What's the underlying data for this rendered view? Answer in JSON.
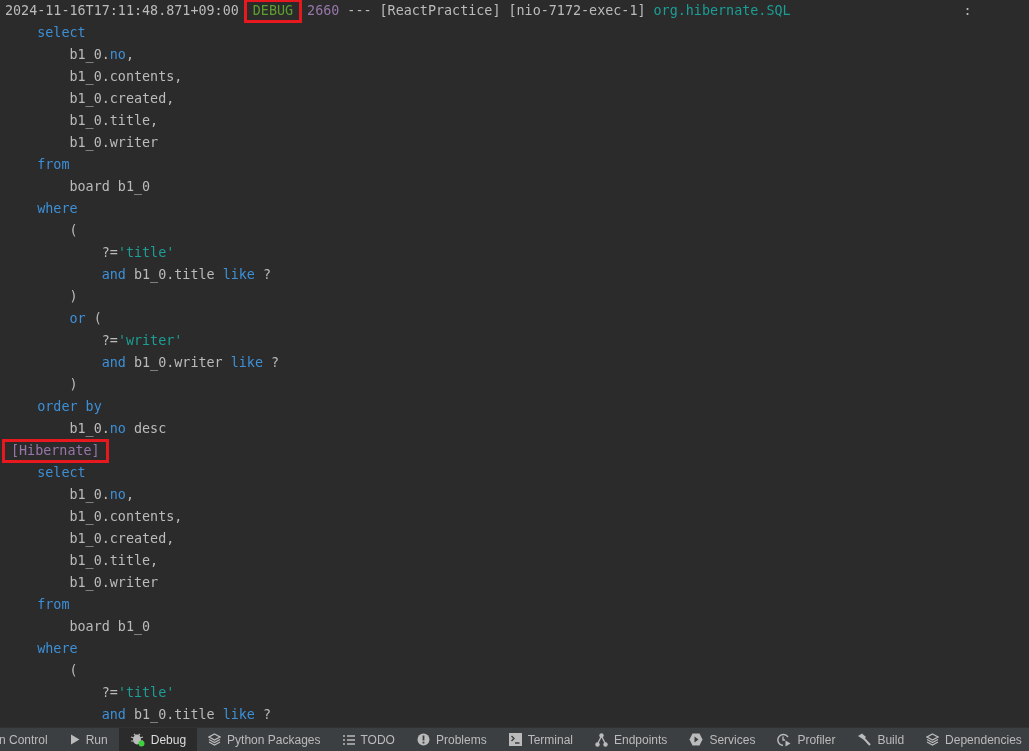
{
  "console": {
    "lines": [
      {
        "kind": "header",
        "tokens": [
          {
            "text": "2024-11-16T17:11:48.871+09:00",
            "kind": "timestamp"
          },
          {
            "text": "DEBUG",
            "kind": "level",
            "boxed": true
          },
          {
            "text": "2660",
            "kind": "pid"
          },
          {
            "text": "---",
            "kind": "plain"
          },
          {
            "text": "[ReactPractice]",
            "kind": "plain"
          },
          {
            "text": "[nio-7172-exec-1]",
            "kind": "plain"
          },
          {
            "text": "org.hibernate.SQL",
            "kind": "logger"
          },
          {
            "text": ":",
            "kind": "colon"
          }
        ]
      },
      {
        "kind": "code",
        "tokens": [
          {
            "text": "    select",
            "kind": "keyword"
          }
        ]
      },
      {
        "kind": "code",
        "tokens": [
          {
            "text": "        b1_0.",
            "kind": "plain"
          },
          {
            "text": "no",
            "kind": "keyword"
          },
          {
            "text": ",",
            "kind": "plain"
          }
        ]
      },
      {
        "kind": "code",
        "tokens": [
          {
            "text": "        b1_0.contents,",
            "kind": "plain"
          }
        ]
      },
      {
        "kind": "code",
        "tokens": [
          {
            "text": "        b1_0.created,",
            "kind": "plain"
          }
        ]
      },
      {
        "kind": "code",
        "tokens": [
          {
            "text": "        b1_0.title,",
            "kind": "plain"
          }
        ]
      },
      {
        "kind": "code",
        "tokens": [
          {
            "text": "        b1_0.writer",
            "kind": "plain"
          }
        ]
      },
      {
        "kind": "code",
        "tokens": [
          {
            "text": "    from",
            "kind": "keyword"
          }
        ]
      },
      {
        "kind": "code",
        "tokens": [
          {
            "text": "        board b1_0",
            "kind": "plain"
          }
        ]
      },
      {
        "kind": "code",
        "tokens": [
          {
            "text": "    where",
            "kind": "keyword"
          }
        ]
      },
      {
        "kind": "code",
        "tokens": [
          {
            "text": "        (",
            "kind": "plain"
          }
        ]
      },
      {
        "kind": "code",
        "tokens": [
          {
            "text": "            ?=",
            "kind": "plain"
          },
          {
            "text": "'title'",
            "kind": "string"
          }
        ]
      },
      {
        "kind": "code",
        "tokens": [
          {
            "text": "            and",
            "kind": "keyword"
          },
          {
            "text": " b1_0.title ",
            "kind": "plain"
          },
          {
            "text": "like",
            "kind": "keyword"
          },
          {
            "text": " ?",
            "kind": "plain"
          }
        ]
      },
      {
        "kind": "code",
        "tokens": [
          {
            "text": "        )",
            "kind": "plain"
          }
        ]
      },
      {
        "kind": "code",
        "tokens": [
          {
            "text": "        or",
            "kind": "keyword"
          },
          {
            "text": " (",
            "kind": "plain"
          }
        ]
      },
      {
        "kind": "code",
        "tokens": [
          {
            "text": "            ?=",
            "kind": "plain"
          },
          {
            "text": "'writer'",
            "kind": "string"
          }
        ]
      },
      {
        "kind": "code",
        "tokens": [
          {
            "text": "            and",
            "kind": "keyword"
          },
          {
            "text": " b1_0.writer ",
            "kind": "plain"
          },
          {
            "text": "like",
            "kind": "keyword"
          },
          {
            "text": " ?",
            "kind": "plain"
          }
        ]
      },
      {
        "kind": "code",
        "tokens": [
          {
            "text": "        )",
            "kind": "plain"
          }
        ]
      },
      {
        "kind": "code",
        "tokens": [
          {
            "text": "    order by",
            "kind": "keyword"
          }
        ]
      },
      {
        "kind": "code",
        "tokens": [
          {
            "text": "        b1_0.",
            "kind": "plain"
          },
          {
            "text": "no",
            "kind": "keyword"
          },
          {
            "text": " desc",
            "kind": "plain"
          }
        ]
      },
      {
        "kind": "header",
        "tokens": [
          {
            "text": "[Hibernate]",
            "kind": "tag",
            "boxed": true
          }
        ]
      },
      {
        "kind": "code",
        "tokens": [
          {
            "text": "    select",
            "kind": "keyword"
          }
        ]
      },
      {
        "kind": "code",
        "tokens": [
          {
            "text": "        b1_0.",
            "kind": "plain"
          },
          {
            "text": "no",
            "kind": "keyword"
          },
          {
            "text": ",",
            "kind": "plain"
          }
        ]
      },
      {
        "kind": "code",
        "tokens": [
          {
            "text": "        b1_0.contents,",
            "kind": "plain"
          }
        ]
      },
      {
        "kind": "code",
        "tokens": [
          {
            "text": "        b1_0.created,",
            "kind": "plain"
          }
        ]
      },
      {
        "kind": "code",
        "tokens": [
          {
            "text": "        b1_0.title,",
            "kind": "plain"
          }
        ]
      },
      {
        "kind": "code",
        "tokens": [
          {
            "text": "        b1_0.writer",
            "kind": "plain"
          }
        ]
      },
      {
        "kind": "code",
        "tokens": [
          {
            "text": "    from",
            "kind": "keyword"
          }
        ]
      },
      {
        "kind": "code",
        "tokens": [
          {
            "text": "        board b1_0",
            "kind": "plain"
          }
        ]
      },
      {
        "kind": "code",
        "tokens": [
          {
            "text": "    where",
            "kind": "keyword"
          }
        ]
      },
      {
        "kind": "code",
        "tokens": [
          {
            "text": "        (",
            "kind": "plain"
          }
        ]
      },
      {
        "kind": "code",
        "tokens": [
          {
            "text": "            ?=",
            "kind": "plain"
          },
          {
            "text": "'title'",
            "kind": "string"
          }
        ]
      },
      {
        "kind": "code",
        "tokens": [
          {
            "text": "            and",
            "kind": "keyword"
          },
          {
            "text": " b1_0.title ",
            "kind": "plain"
          },
          {
            "text": "like",
            "kind": "keyword"
          },
          {
            "text": " ?",
            "kind": "plain"
          }
        ]
      }
    ]
  },
  "tool_window_bar": {
    "tabs": [
      {
        "label": "n Control",
        "selected": false
      },
      {
        "label": "Run",
        "selected": false
      },
      {
        "label": "Debug",
        "selected": true
      },
      {
        "label": "Python Packages",
        "selected": false
      },
      {
        "label": "TODO",
        "selected": false
      },
      {
        "label": "Problems",
        "selected": false
      },
      {
        "label": "Terminal",
        "selected": false
      },
      {
        "label": "Endpoints",
        "selected": false
      },
      {
        "label": "Services",
        "selected": false
      },
      {
        "label": "Profiler",
        "selected": false
      },
      {
        "label": "Build",
        "selected": false
      },
      {
        "label": "Dependencies",
        "selected": false
      }
    ]
  }
}
